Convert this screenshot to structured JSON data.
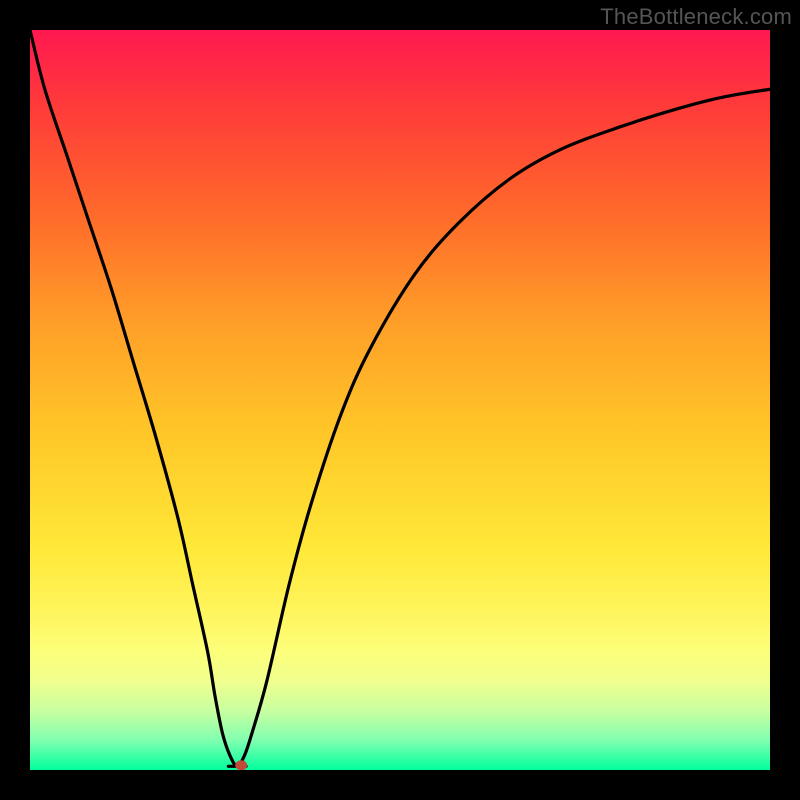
{
  "watermark": "TheBottleneck.com",
  "chart_data": {
    "type": "line",
    "title": "",
    "xlabel": "",
    "ylabel": "",
    "xlim": [
      0,
      100
    ],
    "ylim": [
      0,
      100
    ],
    "grid": false,
    "legend": false,
    "background": "gradient-red-yellow-green",
    "marker": {
      "x": 28,
      "y": 0.5
    },
    "series": [
      {
        "name": "bottleneck-curve",
        "x": [
          0,
          2,
          5,
          8,
          11,
          14,
          17,
          20,
          22,
          24,
          25,
          26,
          27,
          28,
          29,
          30,
          32,
          35,
          38,
          42,
          46,
          52,
          58,
          65,
          72,
          80,
          88,
          94,
          100
        ],
        "y": [
          100,
          92,
          83,
          74,
          65,
          55,
          45,
          34,
          25,
          16,
          10,
          5,
          2,
          0.5,
          2,
          5,
          12,
          25,
          36,
          48,
          57,
          67,
          74,
          80,
          84,
          87,
          89.5,
          91,
          92
        ]
      }
    ]
  }
}
